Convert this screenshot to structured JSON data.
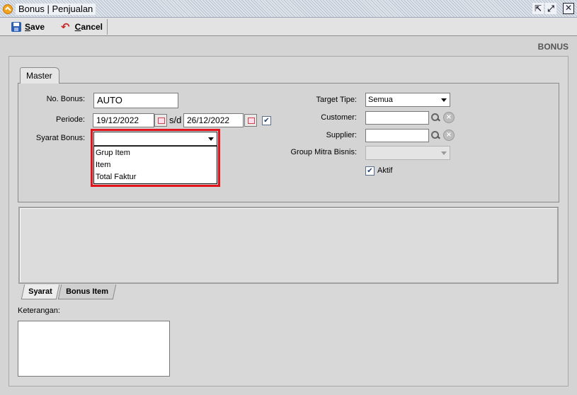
{
  "window": {
    "title": "Bonus | Penjualan",
    "controls": {
      "restore": "⇱",
      "maximize": "⤢",
      "close": "✕"
    }
  },
  "toolbar": {
    "save_label_accel": "S",
    "save_label_rest": "ave",
    "cancel_label_accel": "C",
    "cancel_label_rest": "ancel"
  },
  "page": {
    "heading": "BONUS"
  },
  "tabs": {
    "master": "Master"
  },
  "form": {
    "no_bonus": {
      "label": "No. Bonus:",
      "value": "AUTO"
    },
    "periode": {
      "label": "Periode:",
      "from": "19/12/2022",
      "separator": "s/d",
      "to": "26/12/2022",
      "checked": true
    },
    "syarat_bonus": {
      "label": "Syarat Bonus:",
      "value": "",
      "options": [
        "Grup Item",
        "Item",
        "Total Faktur"
      ],
      "dropdown_open": true
    },
    "target_tipe": {
      "label": "Target Tipe:",
      "value": "Semua"
    },
    "customer": {
      "label": "Customer:",
      "value": ""
    },
    "supplier": {
      "label": "Supplier:",
      "value": ""
    },
    "group_mitra_bisnis": {
      "label": "Group Mitra Bisnis:",
      "value": "",
      "disabled": true
    },
    "aktif": {
      "label": "Aktif",
      "checked": true
    }
  },
  "bottom_tabs": [
    "Syarat",
    "Bonus Item"
  ],
  "keterangan": {
    "label": "Keterangan:",
    "value": ""
  },
  "colors": {
    "highlight": "#e0141a",
    "background": "#d4d4d4"
  },
  "icons": [
    "app-icon",
    "save-icon",
    "cancel-icon",
    "calendar-icon",
    "search-icon",
    "clear-icon",
    "checkbox-checked-icon"
  ]
}
